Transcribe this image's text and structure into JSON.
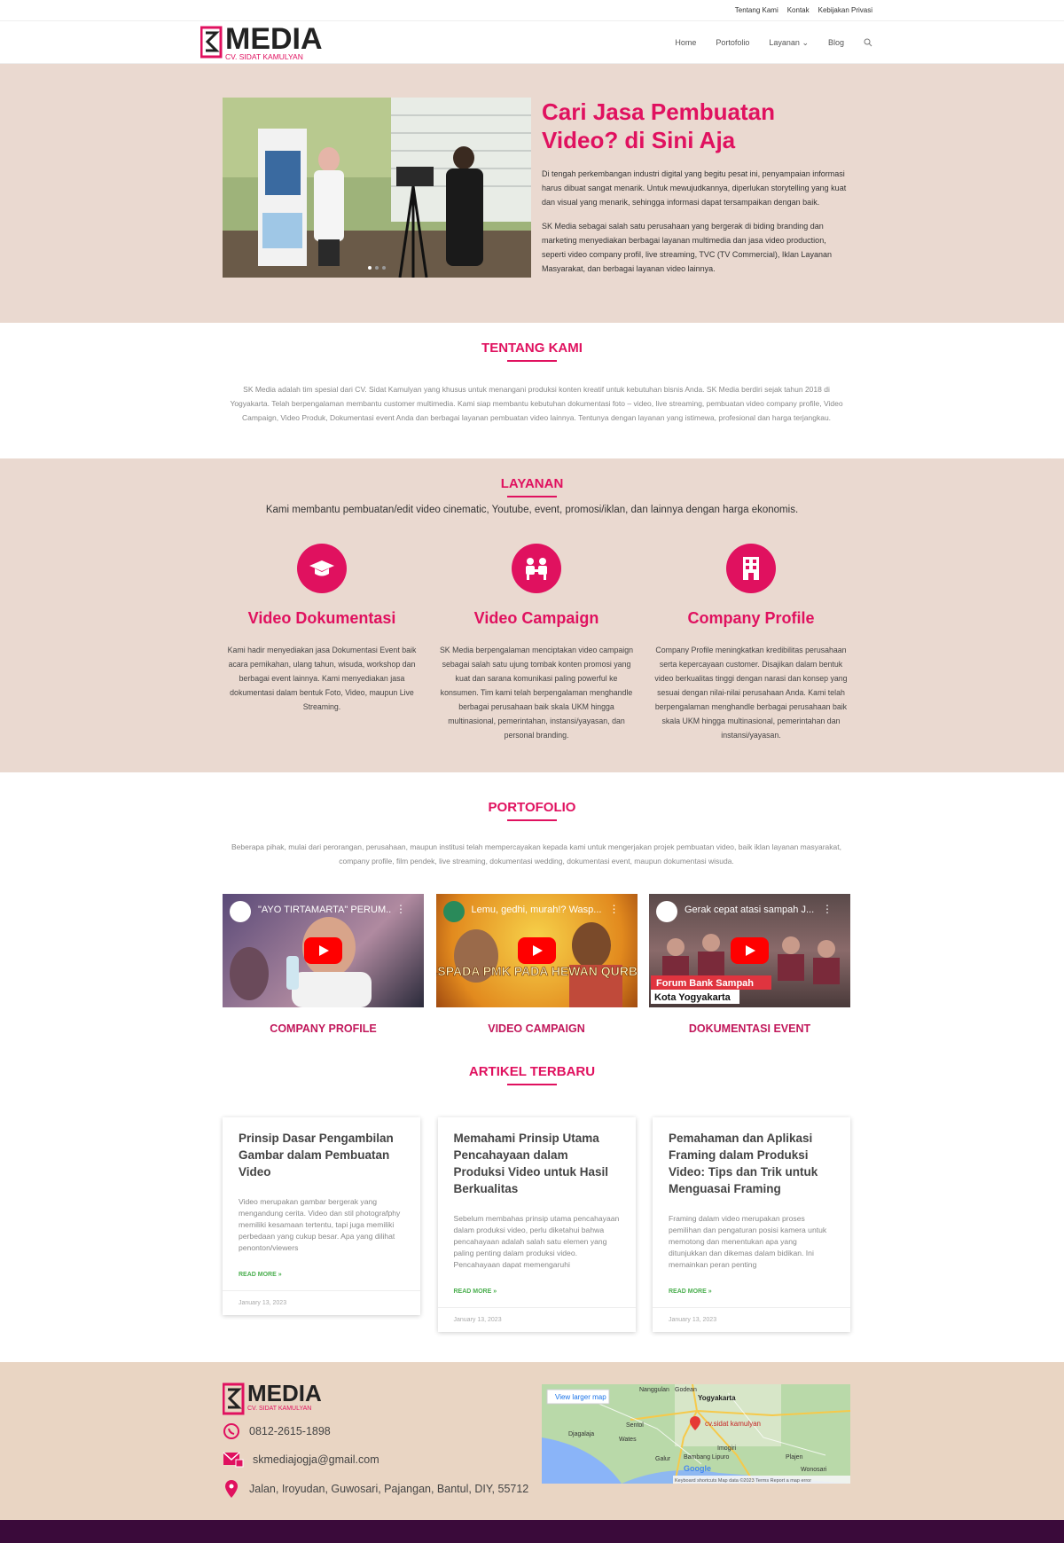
{
  "topbar": {
    "links": [
      "Tentang Kami",
      "Kontak",
      "Kebijakan Privasi"
    ]
  },
  "logo": {
    "main": "MEDIA",
    "sub": "CV. SIDAT KAMULYAN",
    "mark": "SK"
  },
  "nav": {
    "items": [
      "Home",
      "Portofolio",
      "Layanan",
      "Blog"
    ],
    "search_icon": "search-icon"
  },
  "hero": {
    "title": "Cari Jasa Pembuatan Video? di Sini Aja",
    "p1": "Di tengah perkembangan industri digital yang begitu pesat ini, penyampaian informasi harus dibuat sangat menarik. Untuk mewujudkannya, diperlukan storytelling yang kuat dan visual yang menarik, sehingga informasi dapat tersampaikan dengan baik.",
    "p2": "SK Media sebagai salah satu perusahaan yang bergerak di biding branding dan marketing menyediakan berbagai layanan multimedia dan jasa video production, seperti video company profil, live streaming, TVC (TV Commercial), Iklan Layanan Masyarakat, dan berbagai layanan video lainnya."
  },
  "tentang": {
    "title": "TENTANG KAMI",
    "text": "SK Media adalah tim spesial dari CV. Sidat Kamulyan yang khusus untuk menangani produksi konten kreatif untuk kebutuhan bisnis Anda. SK Media berdiri sejak tahun 2018 di Yogyakarta. Telah berpengalaman membantu customer multimedia. Kami siap membantu kebutuhan dokumentasi foto – video, live streaming, pembuatan video company profile, Video Campaign, Video Produk, Dokumentasi event Anda dan berbagai layanan pembuatan video lainnya. Tentunya dengan layanan yang istimewa, profesional dan harga terjangkau."
  },
  "layanan": {
    "title": "LAYANAN",
    "subtitle": "Kami membantu pembuatan/edit video cinematic, Youtube, event, promosi/iklan, dan lainnya dengan harga ekonomis.",
    "items": [
      {
        "icon": "graduation-cap-icon",
        "title": "Video Dokumentasi",
        "text": "Kami hadir menyediakan jasa Dokumentasi Event baik acara pernikahan, ulang tahun, wisuda, workshop dan berbagai event lainnya. Kami menyediakan jasa dokumentasi dalam bentuk Foto, Video, maupun Live Streaming."
      },
      {
        "icon": "people-icon",
        "title": "Video Campaign",
        "text": "SK Media berpengalaman menciptakan video campaign sebagai salah satu ujung tombak konten promosi yang kuat dan sarana komunikasi paling powerful ke konsumen. Tim kami telah berpengalaman menghandle berbagai perusahaan baik skala UKM hingga multinasional, pemerintahan, instansi/yayasan, dan personal branding."
      },
      {
        "icon": "building-icon",
        "title": "Company Profile",
        "text": "Company Profile meningkatkan kredibilitas perusahaan serta kepercayaan customer. Disajikan dalam bentuk video berkualitas tinggi dengan narasi dan konsep yang sesuai dengan nilai-nilai perusahaan Anda. Kami telah berpengalaman menghandle berbagai perusahaan baik skala UKM hingga multinasional, pemerintahan dan instansi/yayasan."
      }
    ]
  },
  "portofolio": {
    "title": "PORTOFOLIO",
    "desc": "Beberapa pihak, mulai dari perorangan, perusahaan, maupun institusi telah mempercayakan kepada kami untuk mengerjakan projek pembuatan video, baik iklan layanan masyarakat, company profile, film pendek, live streaming, dokumentasi wedding, dokumentasi event, maupun dokumentasi wisuda.",
    "videos": [
      {
        "title": "\"AYO TIRTAMARTA\" PERUM...",
        "caption": "COMPANY PROFILE",
        "overlay": ""
      },
      {
        "title": "Lemu, gedhi, murah!? Wasp...",
        "caption": "VIDEO CAMPAIGN",
        "overlay": "WASPADA PMK PADA HEWAN QURBAN"
      },
      {
        "title": "Gerak cepat atasi sampah J...",
        "caption": "DOKUMENTASI EVENT",
        "overlay": "Forum Bank Sampah",
        "overlay2": "Kota Yogyakarta"
      }
    ]
  },
  "artikel": {
    "title": "ARTIKEL TERBARU",
    "read_more": "READ MORE »",
    "cards": [
      {
        "title": "Prinsip Dasar Pengambilan Gambar dalam Pembuatan Video",
        "excerpt": "Video merupakan gambar bergerak yang mengandung cerita. Video dan stil photografphy memiliki kesamaan tertentu, tapi juga memiliki perbedaan yang cukup besar. Apa yang dilihat penonton/viewers",
        "date": "January 13, 2023"
      },
      {
        "title": "Memahami Prinsip Utama Pencahayaan dalam Produksi Video untuk Hasil Berkualitas",
        "excerpt": "Sebelum membahas prinsip utama pencahayaan dalam produksi video, perlu diketahui bahwa pencahayaan adalah salah satu elemen yang paling penting dalam produksi video. Pencahayaan dapat memengaruhi",
        "date": "January 13, 2023"
      },
      {
        "title": "Pemahaman dan Aplikasi Framing dalam Produksi Video: Tips dan Trik untuk Menguasai Framing",
        "excerpt": "Framing dalam video merupakan proses pemilihan dan pengaturan posisi kamera untuk memotong dan menentukan apa yang ditunjukkan dan dikemas dalam bidikan. Ini memainkan peran penting",
        "date": "January 13, 2023"
      }
    ]
  },
  "footer": {
    "phone": "0812-2615-1898",
    "email": "skmediajogja@gmail.com",
    "address": "Jalan, Iroyudan, Guwosari, Pajangan, Bantul, DIY, 55712",
    "map": {
      "larger_link": "View larger map",
      "pin_label": "cv.sidat kamulyan",
      "places": [
        "Yogyakarta",
        "Nanggulan",
        "Godean",
        "Sentol",
        "Djagalaja",
        "Wates",
        "Imogiri",
        "Galur",
        "Bambang Lipuro",
        "Plajen",
        "Wonosari"
      ],
      "footer_text": "Keyboard shortcuts   Map data ©2023   Terms   Report a map error",
      "google": "Google"
    }
  },
  "colors": {
    "accent": "#e0115f",
    "hero_bg": "#ead9d0",
    "footer_bg": "#e9d5c3",
    "bottom_bar": "#3a0a3a",
    "read_more": "#4caf50"
  }
}
